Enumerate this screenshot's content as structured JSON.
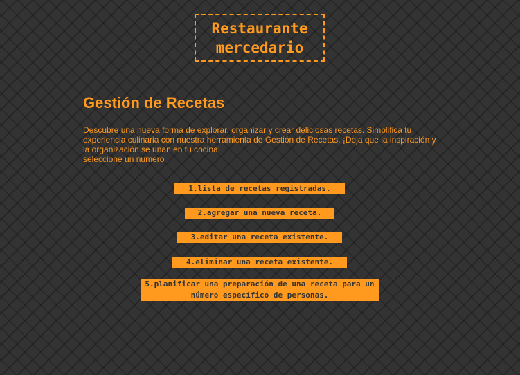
{
  "header": {
    "logo_text": "Restaurante mercedario"
  },
  "main": {
    "title": "Gestión de Recetas",
    "description": "Descubre una nueva forma de explorar, organizar y crear deliciosas recetas. Simplifica tu experiencia culinaria con nuestra herramienta de Gestión de Recetas. ¡Deja que la inspiración y la organización se unan en tu cocina!",
    "prompt": "seleccione un numero",
    "options": [
      {
        "label": "1.lista de recetas registradas."
      },
      {
        "label": "2.agregar una nueva receta."
      },
      {
        "label": "3.editar una receta existente."
      },
      {
        "label": "4.eliminar una receta existente."
      },
      {
        "label": "5.planificar una preparación de una receta para un número específico de personas."
      }
    ]
  },
  "colors": {
    "accent": "#ff9a1f",
    "background": "#333333",
    "button_text": "#333333"
  }
}
